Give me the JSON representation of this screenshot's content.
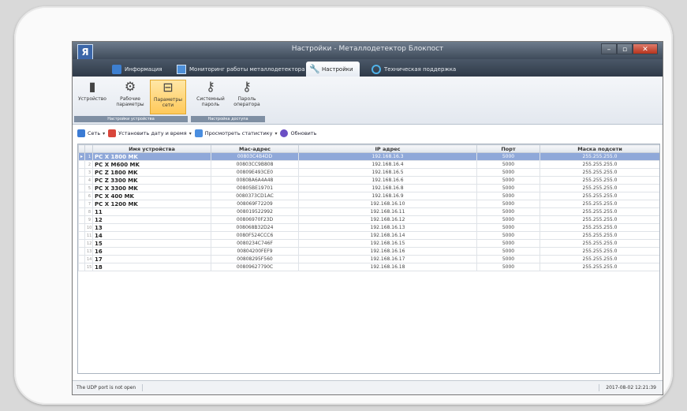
{
  "window": {
    "title": "Настройки - Металлодетектор Блокпост",
    "logo_glyph": "Я"
  },
  "tabs": [
    {
      "label": "Информация",
      "icon": "info-icon"
    },
    {
      "label": "Мониторинг работы металлодетектора",
      "icon": "monitor-icon"
    },
    {
      "label": "Настройки",
      "icon": "wrench-icon",
      "active": true
    },
    {
      "label": "Техническая поддержка",
      "icon": "support-icon"
    }
  ],
  "ribbon": {
    "buttons": [
      {
        "label": "Устройство",
        "icon": "device-icon"
      },
      {
        "label": "Рабочие параметры",
        "icon": "gears-icon"
      },
      {
        "label": "Параметры сети",
        "icon": "network-icon",
        "selected": true
      },
      {
        "label": "Системный пароль",
        "icon": "key-icon"
      },
      {
        "label": "Пароль оператора",
        "icon": "operator-key-icon"
      }
    ],
    "groups": [
      "Настройки устройства",
      "Настройка доступа"
    ]
  },
  "toolbar": {
    "network_label": "Сеть",
    "set_datetime_label": "Установить дату и время",
    "view_stats_label": "Просмотреть статистику",
    "refresh_label": "Обновить"
  },
  "grid": {
    "columns": [
      "Имя устройства",
      "Mac-адрес",
      "IP адрес",
      "Порт",
      "Маска подсети"
    ],
    "rows": [
      {
        "n": "1",
        "name": "PC X 1800 MK",
        "mac": "00803C4B4DD",
        "ip": "192.168.16.3",
        "port": "5000",
        "mask": "255.255.255.0",
        "selected": true
      },
      {
        "n": "2",
        "name": "PC X M600 MK",
        "mac": "00803CC9B808",
        "ip": "192.168.16.4",
        "port": "5000",
        "mask": "255.255.255.0"
      },
      {
        "n": "3",
        "name": "PC Z 1800 MK",
        "mac": "00809E493CE0",
        "ip": "192.168.16.5",
        "port": "5000",
        "mask": "255.255.255.0"
      },
      {
        "n": "4",
        "name": "PC Z 3300 MK",
        "mac": "00808A6A4A48",
        "ip": "192.168.16.6",
        "port": "5000",
        "mask": "255.255.255.0"
      },
      {
        "n": "5",
        "name": "PC X 3300 MK",
        "mac": "00805BE19701",
        "ip": "192.168.16.8",
        "port": "5000",
        "mask": "255.255.255.0"
      },
      {
        "n": "6",
        "name": "PC X 400 MK",
        "mac": "0080373CD1AC",
        "ip": "192.168.16.9",
        "port": "5000",
        "mask": "255.255.255.0"
      },
      {
        "n": "7",
        "name": "PC X 1200 MK",
        "mac": "008069F72209",
        "ip": "192.168.16.10",
        "port": "5000",
        "mask": "255.255.255.0"
      },
      {
        "n": "8",
        "name": "11",
        "mac": "008019522992",
        "ip": "192.168.16.11",
        "port": "5000",
        "mask": "255.255.255.0"
      },
      {
        "n": "9",
        "name": "12",
        "mac": "00806970F23D",
        "ip": "192.168.16.12",
        "port": "5000",
        "mask": "255.255.255.0"
      },
      {
        "n": "10",
        "name": "13",
        "mac": "008068B32D24",
        "ip": "192.168.16.13",
        "port": "5000",
        "mask": "255.255.255.0"
      },
      {
        "n": "11",
        "name": "14",
        "mac": "0080F524CCC6",
        "ip": "192.168.16.14",
        "port": "5000",
        "mask": "255.255.255.0"
      },
      {
        "n": "12",
        "name": "15",
        "mac": "0080234C746F",
        "ip": "192.168.16.15",
        "port": "5000",
        "mask": "255.255.255.0"
      },
      {
        "n": "13",
        "name": "16",
        "mac": "00804200FEF9",
        "ip": "192.168.16.16",
        "port": "5000",
        "mask": "255.255.255.0"
      },
      {
        "n": "14",
        "name": "17",
        "mac": "00808295F560",
        "ip": "192.168.16.17",
        "port": "5000",
        "mask": "255.255.255.0"
      },
      {
        "n": "15",
        "name": "18",
        "mac": "00809627790C",
        "ip": "192.168.16.18",
        "port": "5000",
        "mask": "255.255.255.0"
      }
    ]
  },
  "status": {
    "left": "The UDP port is not open",
    "right": "2017-08-02 12:21:39"
  },
  "colors": {
    "selection": "#8fa8d9",
    "ribbon_selected": "#ffc95a",
    "titlebar": "#3f4b5a"
  }
}
